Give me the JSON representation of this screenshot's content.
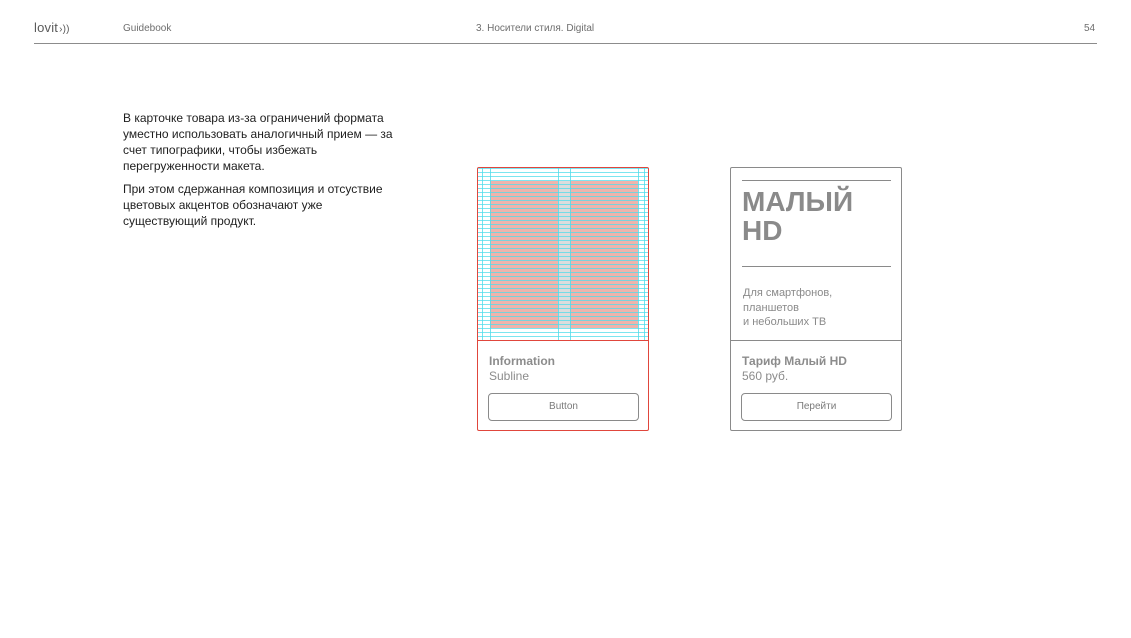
{
  "header": {
    "logo_text": "lovit",
    "logo_mark": "›))",
    "section": "Guidebook",
    "chapter": "3. Носители стиля. Digital",
    "page_number": "54"
  },
  "intro": {
    "paragraph1": "В карточке товара из-за ограничений формата уместно  использовать аналогичный прием — за счет типографики, чтобы избежать перегруженности макета.",
    "paragraph2": "При этом сдержанная композиция и отсуствие цветовых акцентов обозначают уже существующий продукт."
  },
  "card_template": {
    "title": "Information",
    "subline": "Subline",
    "button_label": "Button",
    "accent_color": "#e0463c"
  },
  "card_example": {
    "headline_line1": "МАЛЫЙ",
    "headline_line2": "HD",
    "description_line1": "Для смартфонов,",
    "description_line2": "планшетов",
    "description_line3": "и небольших ТВ",
    "title": "Тариф Малый HD",
    "price": "560 руб.",
    "button_label": "Перейти"
  }
}
